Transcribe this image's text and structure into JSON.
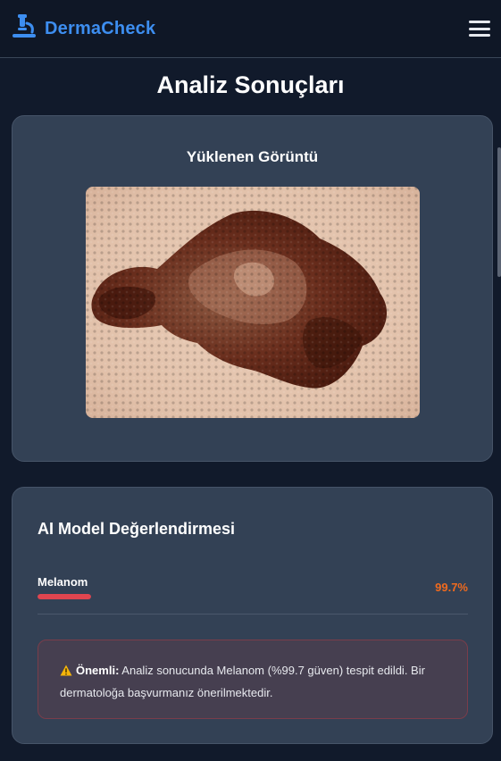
{
  "app": {
    "name": "DermaCheck"
  },
  "page": {
    "title": "Analiz Sonuçları"
  },
  "image_card": {
    "title": "Yüklenen Görüntü"
  },
  "ai_card": {
    "title": "AI Model Değerlendirmesi",
    "results": [
      {
        "label": "Melanom",
        "value_text": "99.7%",
        "value": 99.7
      }
    ],
    "alert": {
      "strong": "Önemli:",
      "text": " Analiz sonucunda Melanom (%99.7 güven) tespit edildi. Bir dermatoloğa başvurmanız önerilmektedir."
    }
  },
  "colors": {
    "brand": "#3d8ef0",
    "bar": "#e0454f",
    "percent": "#f06a1e",
    "warning": "#f5b50a"
  },
  "icons": {
    "logo": "microscope-icon",
    "menu": "hamburger-menu-icon",
    "alert": "warning-triangle-icon"
  }
}
